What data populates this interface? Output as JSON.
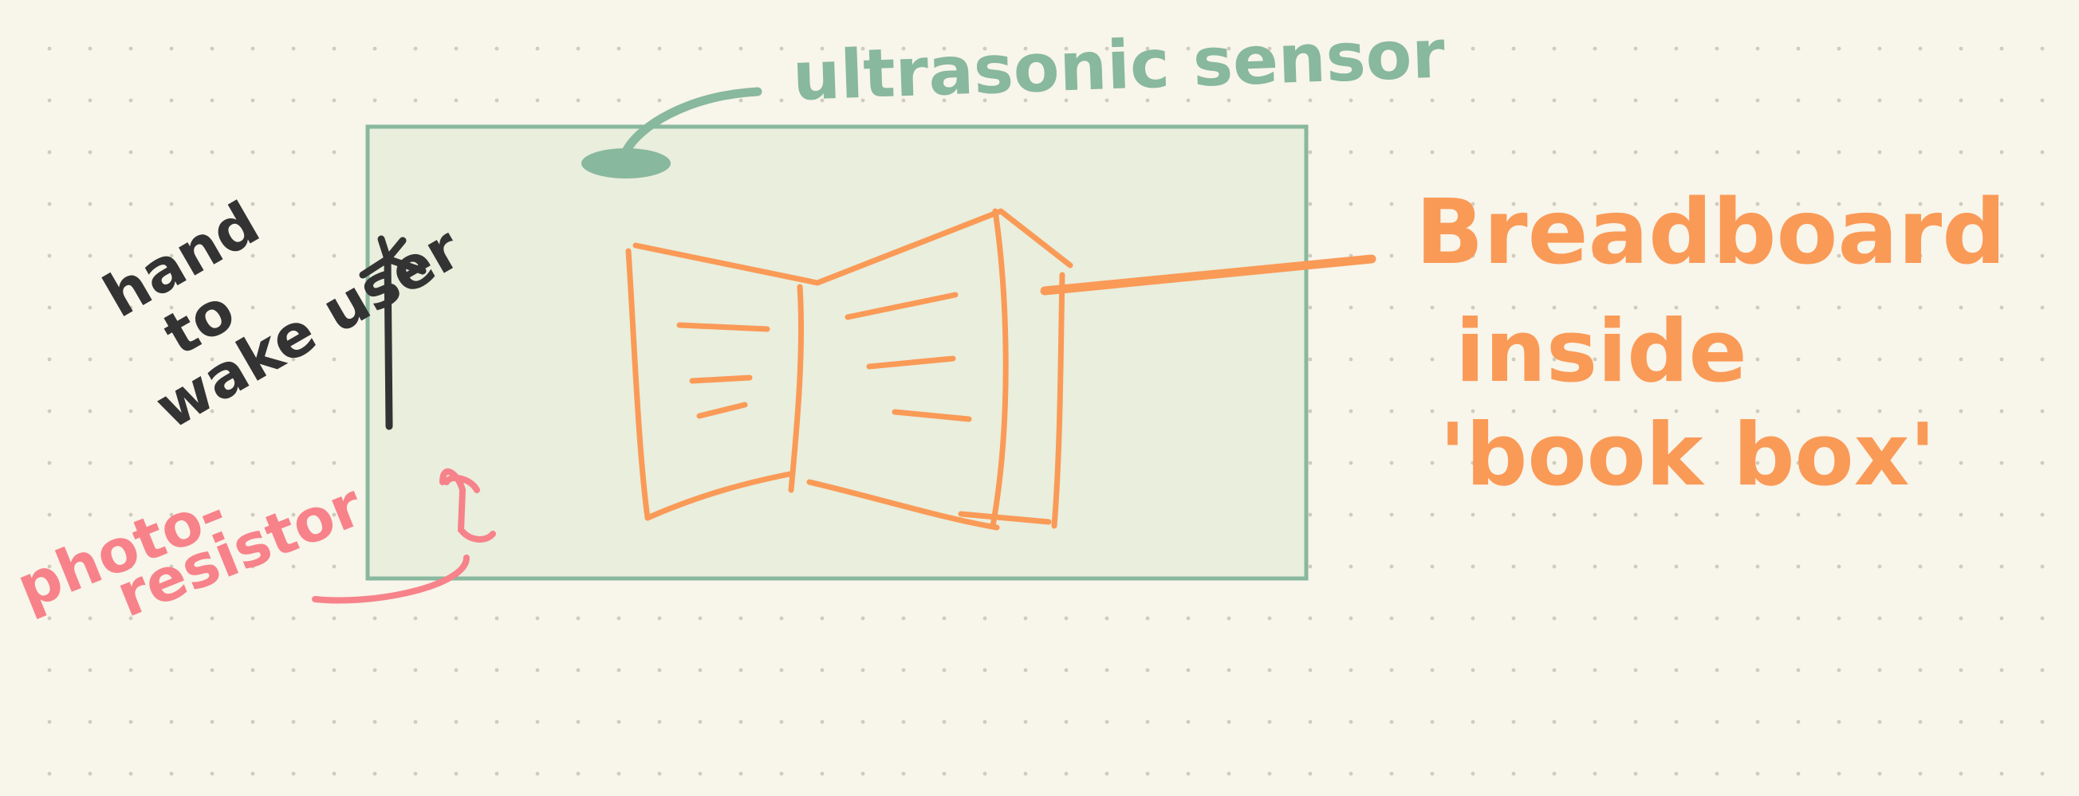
{
  "colors": {
    "paper": "#f8f5ea",
    "dot": "#cfcbbd",
    "green": "#88b89e",
    "green_fill": "#e9eedd",
    "orange": "#fa9a57",
    "pink": "#f7828a",
    "ink": "#333333"
  },
  "labels": {
    "ultrasonic_sensor": "ultrasonic sensor",
    "breadboard": [
      "Breadboard",
      "inside",
      "'book box'"
    ],
    "hand_wake": [
      "hand",
      "to",
      "wake user"
    ],
    "photo_resistor": [
      "photo-",
      "resistor"
    ]
  }
}
